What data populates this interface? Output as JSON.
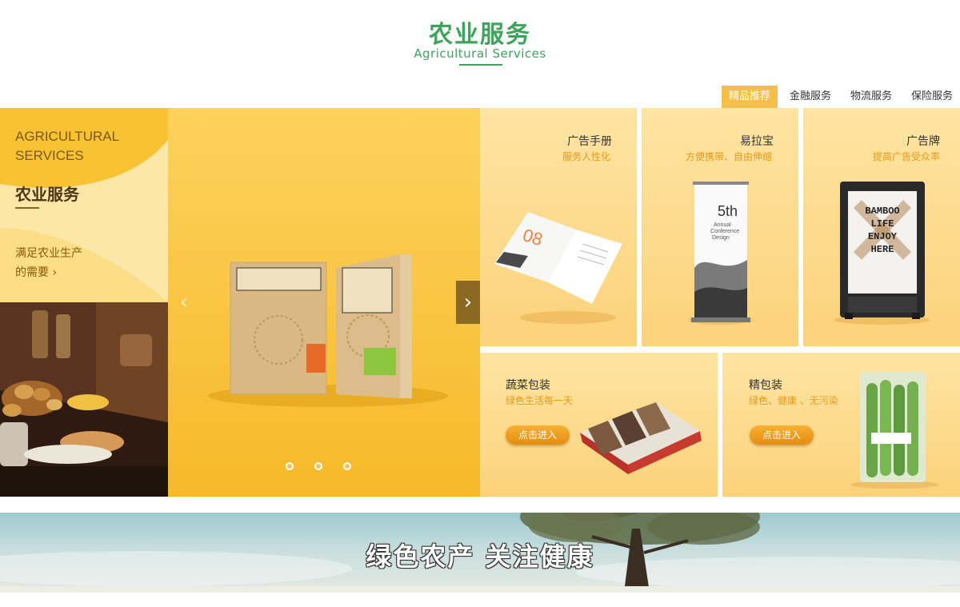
{
  "header": {
    "title": "农业服务",
    "subtitle": "Agricultural Services"
  },
  "tabs": [
    {
      "label": "精品推荐",
      "active": true
    },
    {
      "label": "金融服务",
      "active": false
    },
    {
      "label": "物流服务",
      "active": false
    },
    {
      "label": "保险服务",
      "active": false
    }
  ],
  "left_panel": {
    "en_line1": "AGRICULTURAL",
    "en_line2": "SERVICES",
    "cn_title": "农业服务",
    "need_line1": "满足农业生产",
    "need_line2": "的需要 ›"
  },
  "carousel": {
    "prev_icon": "‹",
    "next_icon": "›",
    "slide_count": 3,
    "active_slide": 1
  },
  "cards": [
    {
      "title": "广告手册",
      "subtitle": "服务人性化"
    },
    {
      "title": "易拉宝",
      "subtitle": "方便携带、自由伸缩",
      "product_text": "5th",
      "product_caption": [
        "Annual",
        "Conference",
        "Design"
      ]
    },
    {
      "title": "广告牌",
      "subtitle": "提高广告受众率",
      "product_text": [
        "BAMBOO",
        "LIFE",
        "ENJOY",
        "HERE"
      ]
    },
    {
      "title": "蔬菜包装",
      "subtitle": "绿色生活每一天",
      "button": "点击进入"
    },
    {
      "title": "精包装",
      "subtitle": "绿色、健康 、无污染",
      "button": "点击进入"
    }
  ],
  "banner": {
    "text": "绿色农产 关注健康"
  },
  "colors": {
    "brand_green": "#3fa35c",
    "accent_yellow": "#f5c049",
    "link_orange": "#e59a1a"
  }
}
